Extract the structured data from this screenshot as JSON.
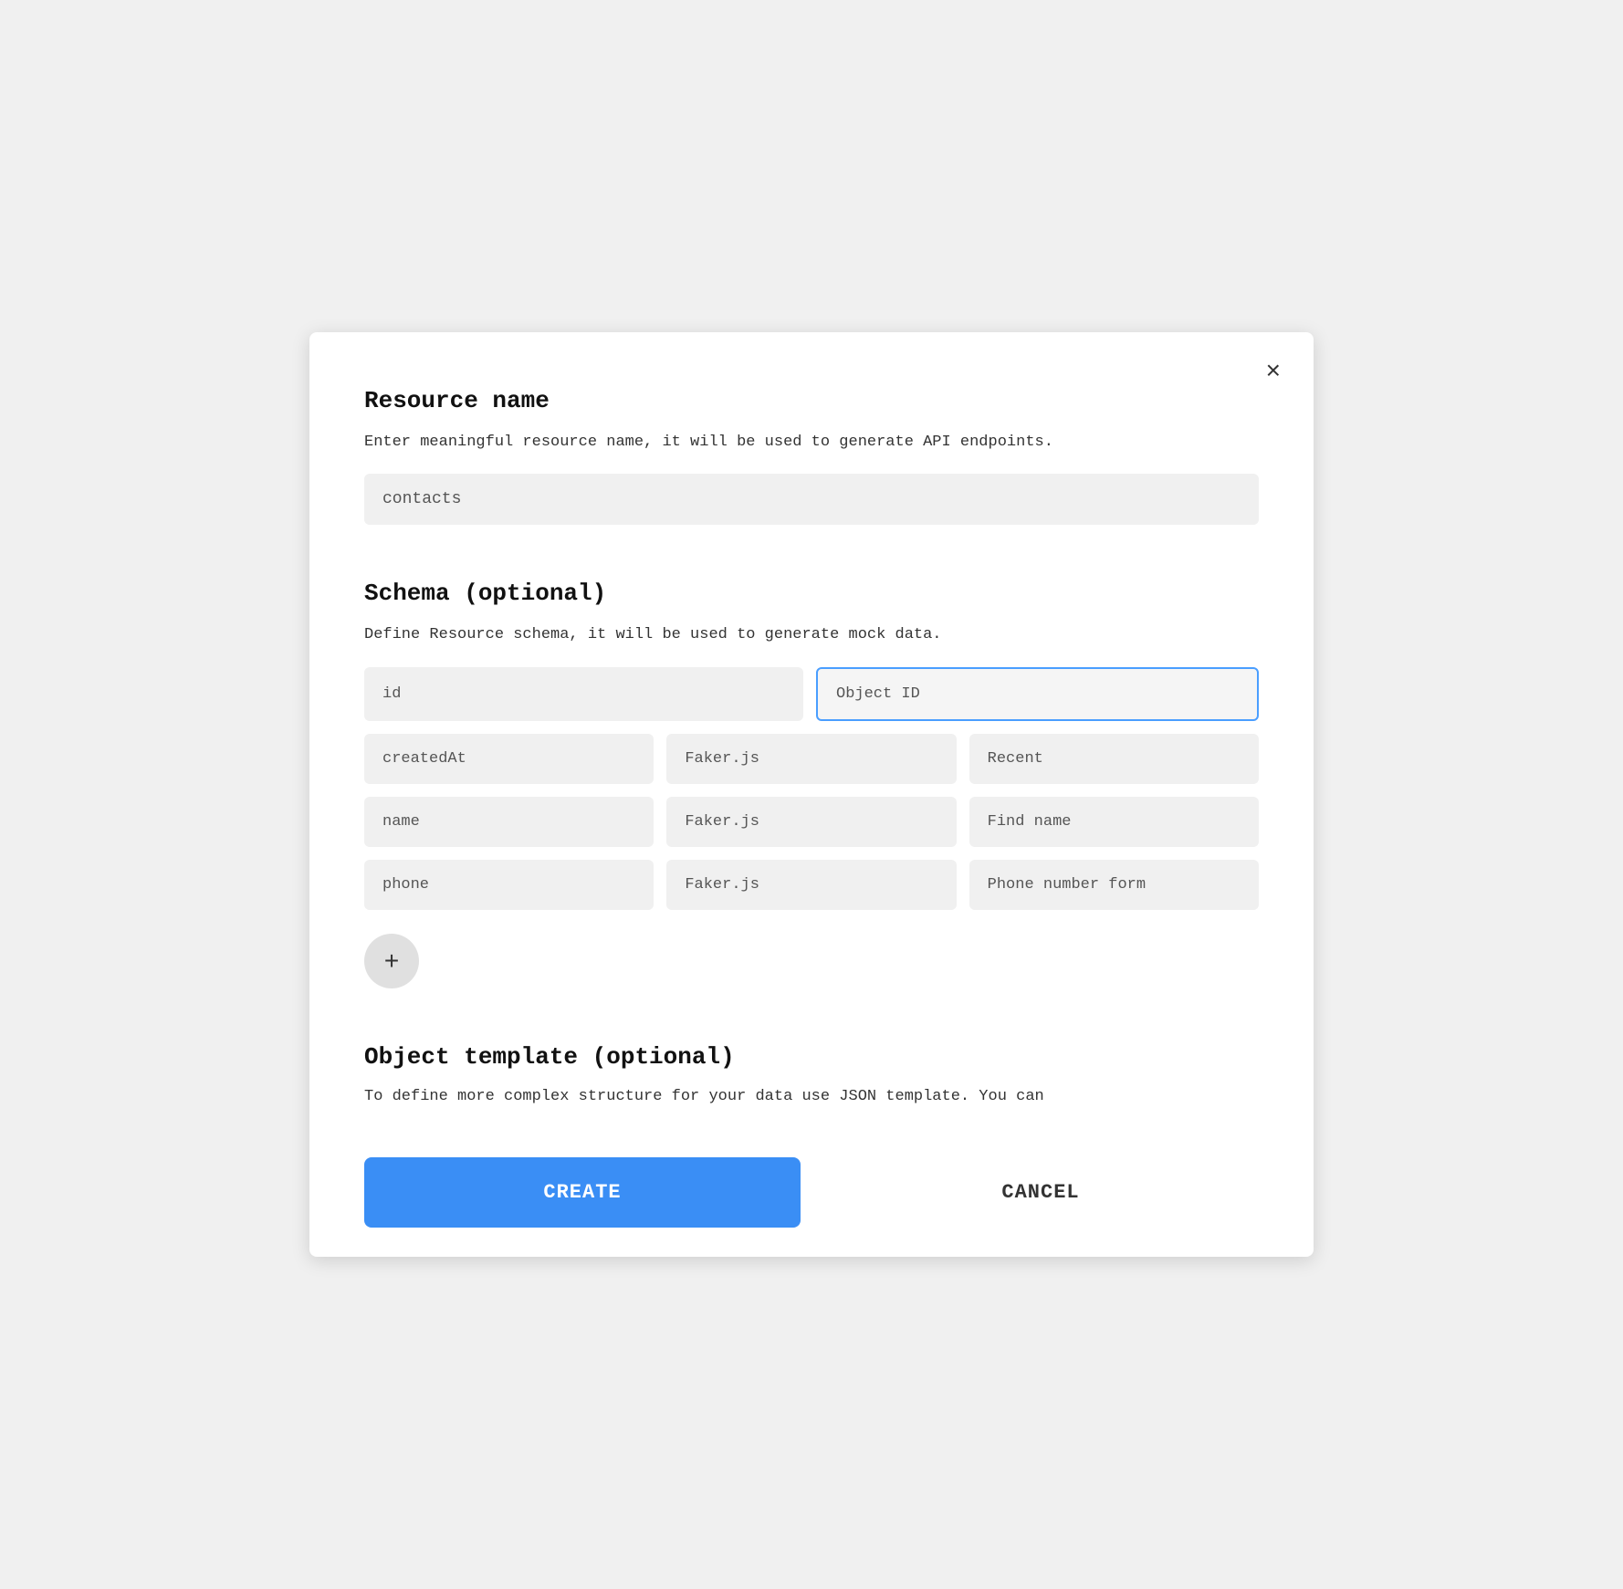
{
  "modal": {
    "close_icon": "×"
  },
  "resource_section": {
    "title": "Resource name",
    "description": "Enter meaningful resource name, it will be used to generate API endpoints.",
    "input_value": "contacts",
    "input_placeholder": "contacts"
  },
  "schema_section": {
    "title": "Schema (optional)",
    "description": "Define Resource schema, it will be used to generate mock data.",
    "rows": [
      {
        "field": "id",
        "type": "Object ID",
        "option": "",
        "type_highlighted": true
      },
      {
        "field": "createdAt",
        "type": "Faker.js",
        "option": "Recent",
        "type_highlighted": false
      },
      {
        "field": "name",
        "type": "Faker.js",
        "option": "Find name",
        "type_highlighted": false
      },
      {
        "field": "phone",
        "type": "Faker.js",
        "option": "Phone number form",
        "type_highlighted": false
      }
    ],
    "add_button_label": "+"
  },
  "object_template_section": {
    "title": "Object template (optional)",
    "description": "To define more complex structure for your data use JSON template. You can"
  },
  "footer": {
    "create_label": "CREATE",
    "cancel_label": "CANCEL"
  }
}
